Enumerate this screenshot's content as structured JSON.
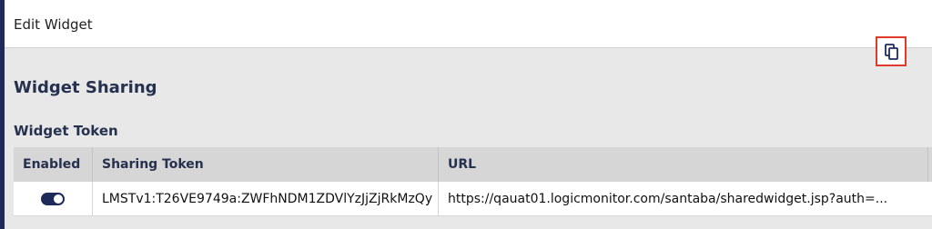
{
  "header": {
    "title": "Edit Widget"
  },
  "section": {
    "title": "Widget Sharing"
  },
  "token_section": {
    "title": "Widget Token"
  },
  "table": {
    "columns": [
      "Enabled",
      "Sharing Token",
      "URL"
    ],
    "rows": [
      {
        "enabled": true,
        "token": "LMSTv1:T26VE9749a:ZWFhNDM1ZDVlYzJjZjRkMzQy",
        "url": "https://qauat01.logicmonitor.com/santaba/sharedwidget.jsp?auth=..."
      }
    ]
  },
  "icons": {
    "toggle": "toggle-switch-icon",
    "copy": "copy-icon"
  },
  "colors": {
    "accent": "#1e2a5a",
    "highlight": "#e03b2a",
    "header_bg": "#d6d6d6"
  }
}
